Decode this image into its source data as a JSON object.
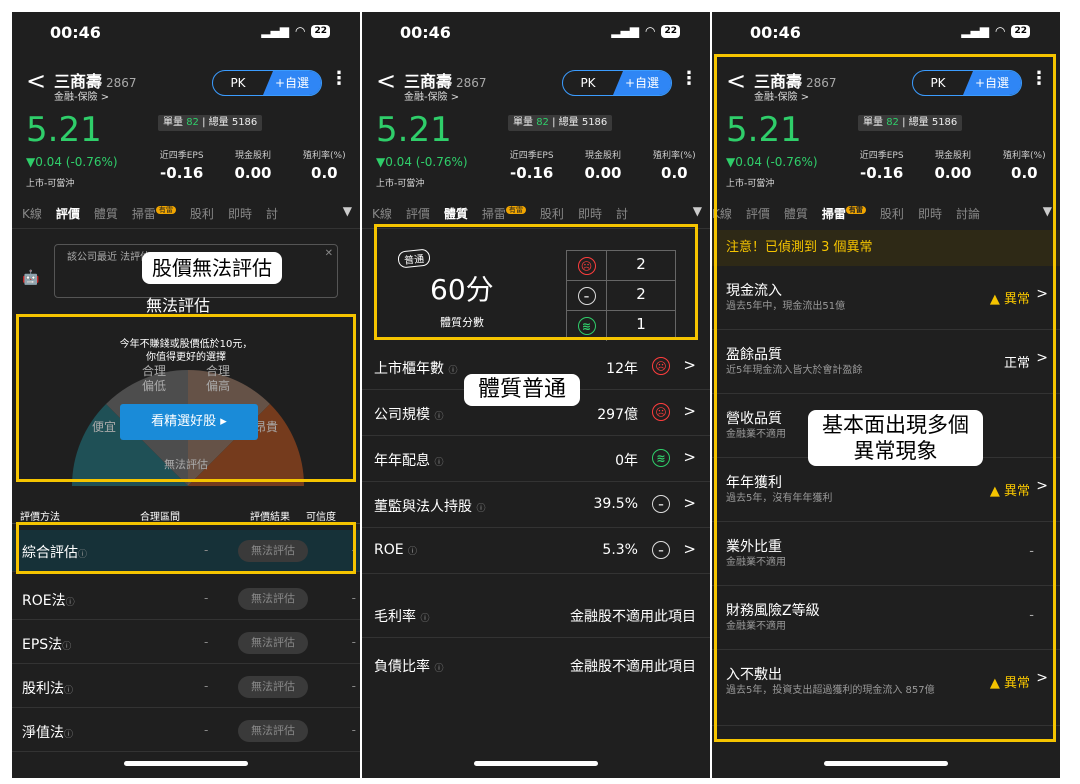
{
  "status": {
    "time": "00:46",
    "bell": "🔕",
    "signal": "▮▮▮",
    "wifi": "WiFi",
    "battery": "22"
  },
  "stock": {
    "name": "三商壽",
    "code": "2867",
    "category": "金融-保險 >",
    "price": "5.21",
    "volume_label": "單量",
    "volume_value": "82",
    "total_label": "總量 5186",
    "change": "▼0.04 (-0.76%)",
    "market": "上市-可當沖",
    "pk": "PK",
    "add": "+自選",
    "more": "⋮",
    "back": "<",
    "metrics": [
      {
        "label": "近四季EPS",
        "value": "-0.16"
      },
      {
        "label": "現金股利",
        "value": "0.00"
      },
      {
        "label": "殖利率(%)",
        "value": "0.0"
      }
    ]
  },
  "tabs": [
    "K線",
    "評價",
    "體質",
    "掃雷",
    "股利",
    "即時",
    "討"
  ],
  "tabs3": [
    "K線",
    "評價",
    "體質",
    "掃雷",
    "股利",
    "即時",
    "討論"
  ],
  "tab_badge": "有雷",
  "tab_arrow": "▼",
  "p1": {
    "note_text": "該公司最近 法評估。",
    "callout": "股價無法評估",
    "sub_title": "無法評估",
    "gauge_msg1": "今年不賺錢或股價低於10元，",
    "gauge_msg2": "你值得更好的選擇",
    "g_left": "便宜",
    "g_right": "昂貴",
    "g_mid1a": "合理",
    "g_mid1b": "偏低",
    "g_mid2a": "合理",
    "g_mid2b": "偏高",
    "button": "看精選好股 ▸",
    "gauge_na": "無法評估",
    "headers": [
      "評價方法",
      "合理區間",
      "評價結果",
      "可信度"
    ],
    "rows": [
      {
        "name": "綜合評估",
        "dash": "-",
        "result": "無法評估",
        "dash2": "-"
      },
      {
        "name": "ROE法",
        "dash": "-",
        "result": "無法評估",
        "dash2": "-"
      },
      {
        "name": "EPS法",
        "dash": "-",
        "result": "無法評估",
        "dash2": "-"
      },
      {
        "name": "股利法",
        "dash": "-",
        "result": "無法評估",
        "dash2": "-"
      },
      {
        "name": "淨值法",
        "dash": "-",
        "result": "無法評估",
        "dash2": "-"
      }
    ]
  },
  "p2": {
    "pill": "普通",
    "score": "60分",
    "score_label": "體質分數",
    "counts": {
      "bad": "2",
      "neutral": "2",
      "good": "1"
    },
    "callout": "體質普通",
    "rows": [
      {
        "name": "上市櫃年數",
        "value": "12年",
        "face": "bad"
      },
      {
        "name": "公司規模",
        "value": "297億",
        "face": "bad"
      },
      {
        "name": "年年配息",
        "value": "0年",
        "face": "good"
      },
      {
        "name": "董監與法人持股",
        "value": "39.5%",
        "face": "neutral"
      },
      {
        "name": "ROE",
        "value": "5.3%",
        "face": "neutral"
      }
    ],
    "na_rows": [
      {
        "name": "毛利率",
        "value": "金融股不適用此項目"
      },
      {
        "name": "負債比率",
        "value": "金融股不適用此項目"
      }
    ]
  },
  "p3": {
    "warning": "注意！已偵測到 3 個異常",
    "callout1": "基本面出現多個",
    "callout2": "異常現象",
    "rows": [
      {
        "name": "現金流入",
        "desc": "過去5年中，現金流出51億",
        "status": "▲ 異常",
        "type": "bad"
      },
      {
        "name": "盈餘品質",
        "desc": "近5年現金流入皆大於會計盈餘",
        "status": "正常",
        "type": "ok"
      },
      {
        "name": "營收品質",
        "desc": "金融業不適用",
        "status": "",
        "type": "none"
      },
      {
        "name": "年年獲利",
        "desc": "過去5年，沒有年年獲利",
        "status": "▲ 異常",
        "type": "bad"
      },
      {
        "name": "業外比重",
        "desc": "金融業不適用",
        "status": "-",
        "type": "dash"
      },
      {
        "name": "財務風險Z等級",
        "desc": "金融業不適用",
        "status": "-",
        "type": "dash"
      },
      {
        "name": "入不敷出",
        "desc": "過去5年，投資支出超過獲利的現金流入 857億",
        "status": "▲ 異常",
        "type": "bad"
      }
    ]
  },
  "info_icon": "ⓘ",
  "chev": ">",
  "face_glyph": {
    "bad": "☹",
    "neutral": "–",
    "good": "≋"
  }
}
